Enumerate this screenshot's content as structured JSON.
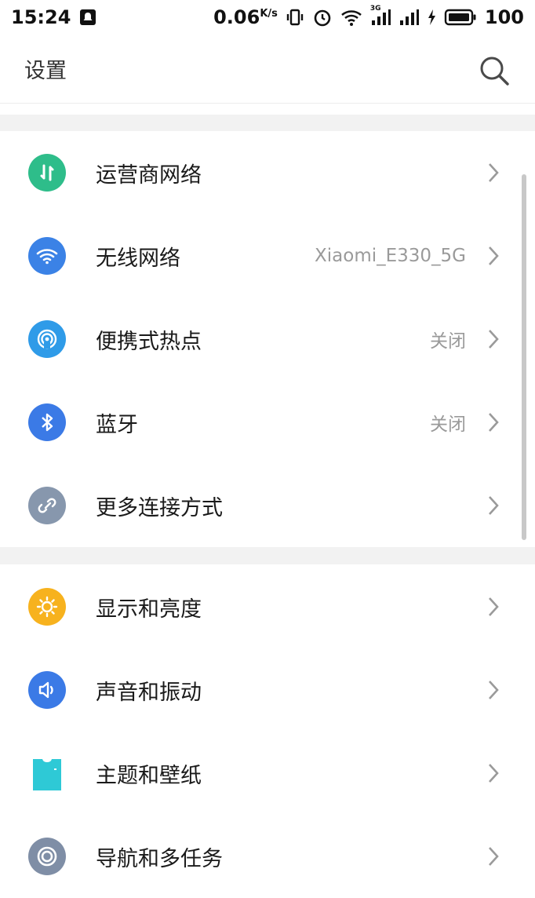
{
  "status_bar": {
    "time": "15:24",
    "net_speed": "0.06",
    "net_speed_unit": "K/s",
    "network_type": "3G",
    "battery": "100"
  },
  "header": {
    "title": "设置"
  },
  "sections": [
    {
      "items": [
        {
          "label": "运营商网络",
          "value": "",
          "icon": "carrier-network-icon",
          "color": "#2ebd8a"
        },
        {
          "label": "无线网络",
          "value": "Xiaomi_E330_5G",
          "icon": "wifi-icon",
          "color": "#3b82e6"
        },
        {
          "label": "便携式热点",
          "value": "关闭",
          "icon": "hotspot-icon",
          "color": "#2f9be8"
        },
        {
          "label": "蓝牙",
          "value": "关闭",
          "icon": "bluetooth-icon",
          "color": "#3b7ae6"
        },
        {
          "label": "更多连接方式",
          "value": "",
          "icon": "link-icon",
          "color": "#8797ad"
        }
      ]
    },
    {
      "items": [
        {
          "label": "显示和亮度",
          "value": "",
          "icon": "brightness-icon",
          "color": "#f7b21e"
        },
        {
          "label": "声音和振动",
          "value": "",
          "icon": "sound-icon",
          "color": "#3b7ae6"
        },
        {
          "label": "主题和壁纸",
          "value": "",
          "icon": "theme-icon",
          "color": "#2ec9d6"
        },
        {
          "label": "导航和多任务",
          "value": "",
          "icon": "navigation-icon",
          "color": "#7f8ea6"
        }
      ]
    }
  ]
}
